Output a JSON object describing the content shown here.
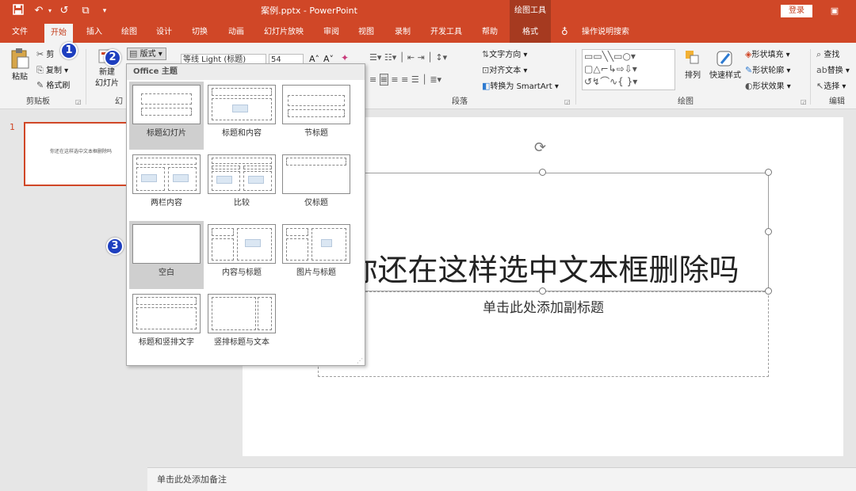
{
  "qat": {
    "save_icon": "save-icon",
    "undo_icon": "undo-icon",
    "redo_icon": "redo-icon",
    "present_icon": "present-icon",
    "customize_icon": "customize-icon"
  },
  "window": {
    "title": "案例.pptx  -  PowerPoint",
    "drawing_tools": "绘图工具",
    "login": "登录"
  },
  "tabs": [
    "文件",
    "开始",
    "插入",
    "绘图",
    "设计",
    "切换",
    "动画",
    "幻灯片放映",
    "审阅",
    "视图",
    "录制",
    "开发工具",
    "帮助",
    "格式"
  ],
  "active_tab": "开始",
  "tell_me": "操作说明搜索",
  "ribbon": {
    "clipboard": {
      "paste": "粘贴",
      "cut": "剪",
      "copy": "复制",
      "format_painter": "格式刷",
      "label": "剪贴板"
    },
    "slides": {
      "new_slide_line1": "新建",
      "new_slide_line2": "幻灯片",
      "layout": "版式",
      "label": "幻"
    },
    "font": {
      "name": "等线 Light (标题)",
      "size": "54"
    },
    "paragraph": {
      "text_direction": "文字方向",
      "align_text": "对齐文本",
      "convert_smartart": "转换为 SmartArt",
      "label": "段落"
    },
    "drawing": {
      "arrange": "排列",
      "quick_styles": "快速样式",
      "shape_fill": "形状填充",
      "shape_outline": "形状轮廓",
      "shape_effects": "形状效果",
      "label": "绘图"
    },
    "editing": {
      "find": "查找",
      "replace": "替换",
      "select": "选择",
      "label": "编辑"
    }
  },
  "gallery": {
    "header": "Office 主题",
    "layouts": [
      "标题幻灯片",
      "标题和内容",
      "节标题",
      "两栏内容",
      "比较",
      "仅标题",
      "空白",
      "内容与标题",
      "图片与标题",
      "标题和竖排文字",
      "竖排标题与文本"
    ]
  },
  "badges": [
    "1",
    "2",
    "3"
  ],
  "thumbnail": {
    "number": "1",
    "text": "你还在这样选中文本框删除吗"
  },
  "slide": {
    "title": "你还在这样选中文本框删除吗",
    "subtitle": "单击此处添加副标题"
  },
  "notes": "单击此处添加备注",
  "colors": {
    "accent": "#d04727",
    "badge": "#1e3fbf"
  }
}
